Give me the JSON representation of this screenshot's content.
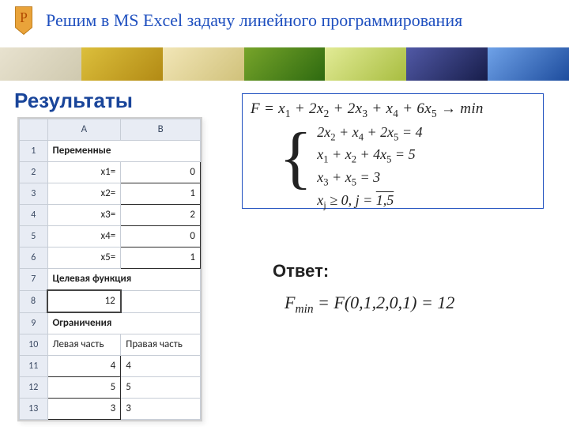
{
  "header": {
    "badge_letter": "P",
    "title": "Решим в MS Excel задачу линейного программирования"
  },
  "results_title": "Результаты",
  "excel": {
    "col_headers": {
      "A": "A",
      "B": "B"
    },
    "rows": {
      "r1_label": "Переменные",
      "vars": [
        {
          "n": "2",
          "name": "x1=",
          "value": "0"
        },
        {
          "n": "3",
          "name": "x2=",
          "value": "1"
        },
        {
          "n": "4",
          "name": "x3=",
          "value": "2"
        },
        {
          "n": "5",
          "name": "x4=",
          "value": "0"
        },
        {
          "n": "6",
          "name": "x5=",
          "value": "1"
        }
      ],
      "r7_label": "Целевая функция",
      "obj_row": {
        "n": "8",
        "value": "12"
      },
      "r9_label": "Ограничения",
      "r10_left": "Левая часть",
      "r10_right": "Правая часть",
      "constraints": [
        {
          "n": "11",
          "lhs": "4",
          "rhs": "4"
        },
        {
          "n": "12",
          "lhs": "5",
          "rhs": "5"
        },
        {
          "n": "13",
          "lhs": "3",
          "rhs": "3"
        }
      ]
    }
  },
  "lp": {
    "objective_terms": [
      "F = x",
      "1",
      " + 2x",
      "2",
      " + 2x",
      "3",
      " + x",
      "4",
      " + 6x",
      "5",
      " → min"
    ],
    "line1": [
      "2x",
      "2",
      " + x",
      "4",
      " + 2x",
      "5",
      " = 4"
    ],
    "line2": [
      "x",
      "1",
      " + x",
      "2",
      " + 4x",
      "5",
      " = 5"
    ],
    "line3": [
      "x",
      "3",
      " + x",
      "5",
      " = 3"
    ],
    "line4_pre": "xj ≥ 0, j = ",
    "line4_range": "1,5"
  },
  "answer": {
    "label": "Ответ:",
    "prefix": "F",
    "sub": "min",
    "mid": " = F(0,1,2,0,1) = 12"
  }
}
